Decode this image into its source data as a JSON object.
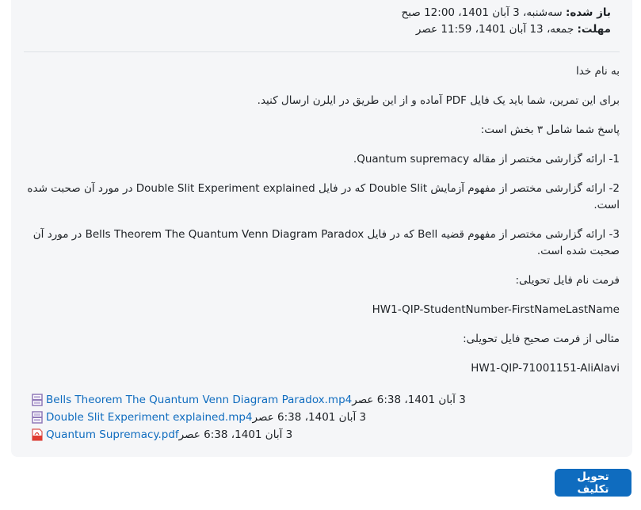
{
  "dates": {
    "opened_label": "باز شده:",
    "opened_value": "سه‌شنبه، 3 آبان 1401، 12:00 صبح",
    "due_label": "مهلت:",
    "due_value": "جمعه، 13 آبان 1401، 11:59 عصر"
  },
  "description": {
    "p1": "به نام خدا",
    "p2": "برای این تمرین، شما باید یک فایل PDF آماده و از این طریق در ایلرن ارسال کنید.",
    "p3": "پاسخ شما شامل ۳ بخش است:",
    "p4": "1- ارائه گزارشی مختصر از مقاله Quantum supremacy.",
    "p5": "2- ارائه گزارشی مختصر از مفهوم آزمایش Double Slit که در فایل Double Slit Experiment explained در مورد آن صحبت شده است.",
    "p6": "3- ارائه گزارشی مختصر از مفهوم قضیه Bell که در فایل Bells Theorem The Quantum Venn Diagram Paradox در مورد آن صحبت شده است.",
    "p7": "فرمت نام فایل تحویلی:",
    "p8": "HW1-QIP-StudentNumber-FirstNameLastName",
    "p9": "مثالی از فرمت صحیح فایل تحویلی:",
    "p10": "HW1-QIP-71001151-AliAlavi"
  },
  "files": [
    {
      "name": "Bells Theorem The Quantum Venn Diagram Paradox.mp4",
      "date": "3 آبان 1401، 6:38 عصر",
      "icon": "video-file-icon"
    },
    {
      "name": "Double Slit Experiment explained.mp4",
      "date": "3 آبان 1401، 6:38 عصر",
      "icon": "video-file-icon"
    },
    {
      "name": "Quantum Supremacy.pdf",
      "date": "3 آبان 1401، 6:38 عصر",
      "icon": "pdf-file-icon"
    }
  ],
  "submit_label": "تحویل تکلیف",
  "colors": {
    "link": "#0f6cbf",
    "button": "#0f6cbf",
    "card_bg": "#f5f6f8"
  }
}
